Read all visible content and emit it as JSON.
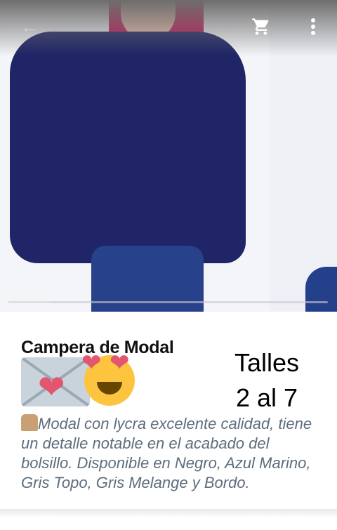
{
  "header": {
    "back_icon": "arrow-left-icon",
    "cart_icon": "shopping-cart-icon",
    "menu_icon": "more-vertical-icon"
  },
  "hero": {
    "image": "Woman wearing navy modal zip jacket",
    "carousel_position": 1
  },
  "product": {
    "title": "Campera de Modal",
    "title_emojis": [
      "love-letter",
      "heart-eyes-face"
    ],
    "sizes_line1": "Talles",
    "sizes_line2": "2 al 7",
    "description_emoji": "coat",
    "description": "Modal con lycra excelente calidad, tiene un detalle notable en el acabado del bolsillo. Disponible en Negro, Azul Marino, Gris Topo, Gris Melange y Bordo."
  },
  "colors": {
    "text_title": "#111111",
    "description": "#5d6d7c",
    "heart": "#e3566f"
  }
}
